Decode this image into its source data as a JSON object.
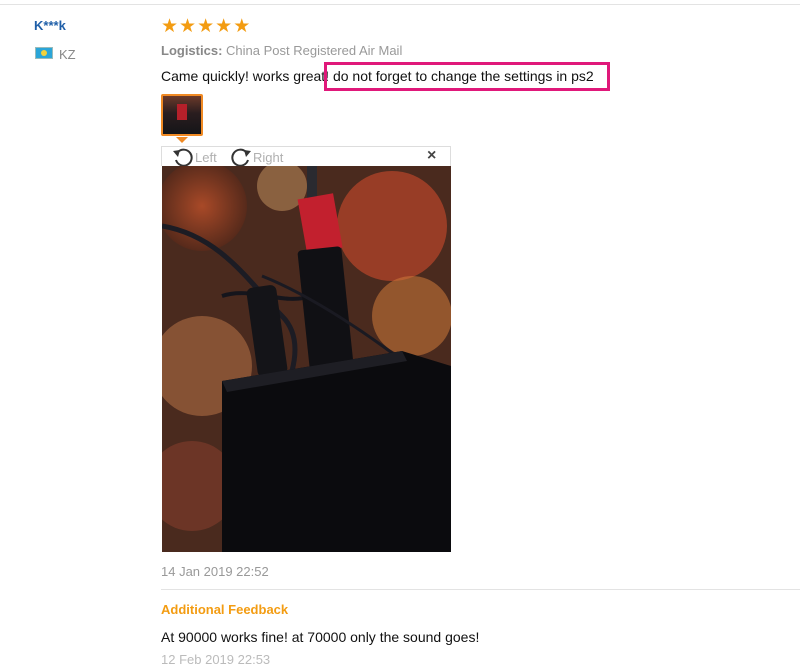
{
  "reviewer": {
    "name": "K***k",
    "country": "KZ",
    "flag_icon": "kazakhstan-flag-icon"
  },
  "rating": {
    "stars": 5,
    "max": 5,
    "star_glyph": "★"
  },
  "logistics": {
    "label": "Logistics:",
    "value": "China Post Registered Air Mail"
  },
  "review": {
    "text": "Came quickly! works great! do not forget to change the settings in ps2"
  },
  "viewer": {
    "rotate_left_label": "Left",
    "rotate_right_label": "Right",
    "close_glyph": "×"
  },
  "date": "14 Jan 2019 22:52",
  "additional_feedback": {
    "title": "Additional Feedback",
    "text": "At 90000 works fine! at 70000 only the sound goes!",
    "date": "12 Feb 2019 22:53"
  },
  "colors": {
    "accent": "#f39c12",
    "link": "#1f5fa8",
    "highlight": "#e0187a"
  }
}
